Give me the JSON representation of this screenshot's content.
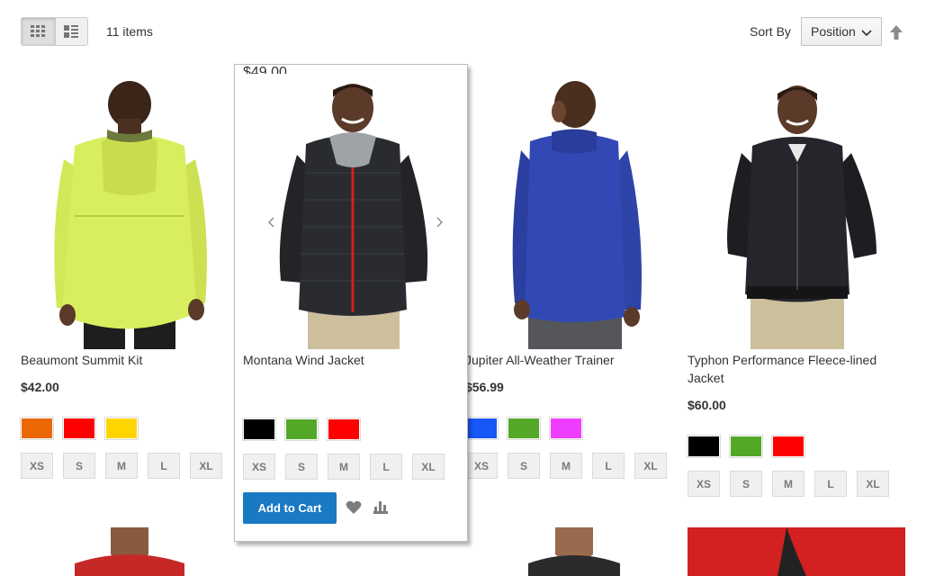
{
  "toolbar": {
    "amount": "11 items",
    "sort_label": "Sort By",
    "sort_value": "Position",
    "view_modes": [
      "grid-icon",
      "list-icon"
    ],
    "sort_direction_icon": "arrow-up-icon"
  },
  "products": [
    {
      "name": "Beaumont Summit Kit",
      "price": "$42.00",
      "colors": [
        "#eb6703",
        "#ff0000",
        "#ffd500"
      ],
      "sizes": [
        "XS",
        "S",
        "M",
        "L",
        "XL"
      ]
    },
    {
      "name": "Montana Wind Jacket",
      "price": "$49.00",
      "colors": [
        "#000000",
        "#53a828",
        "#ff0000"
      ],
      "sizes": [
        "XS",
        "S",
        "M",
        "L",
        "XL"
      ],
      "add_to_cart": "Add to Cart"
    },
    {
      "name": "Jupiter All-Weather Trainer",
      "price": "$56.99",
      "colors": [
        "#1857f7",
        "#53a828",
        "#ef3dff"
      ],
      "sizes": [
        "XS",
        "S",
        "M",
        "L",
        "XL"
      ]
    },
    {
      "name": "Typhon Performance Fleece-lined Jacket",
      "price": "$60.00",
      "colors": [
        "#000000",
        "#53a828",
        "#ff0000"
      ],
      "sizes": [
        "XS",
        "S",
        "M",
        "L",
        "XL"
      ]
    }
  ],
  "colors": {
    "accent": "#1979c3"
  }
}
